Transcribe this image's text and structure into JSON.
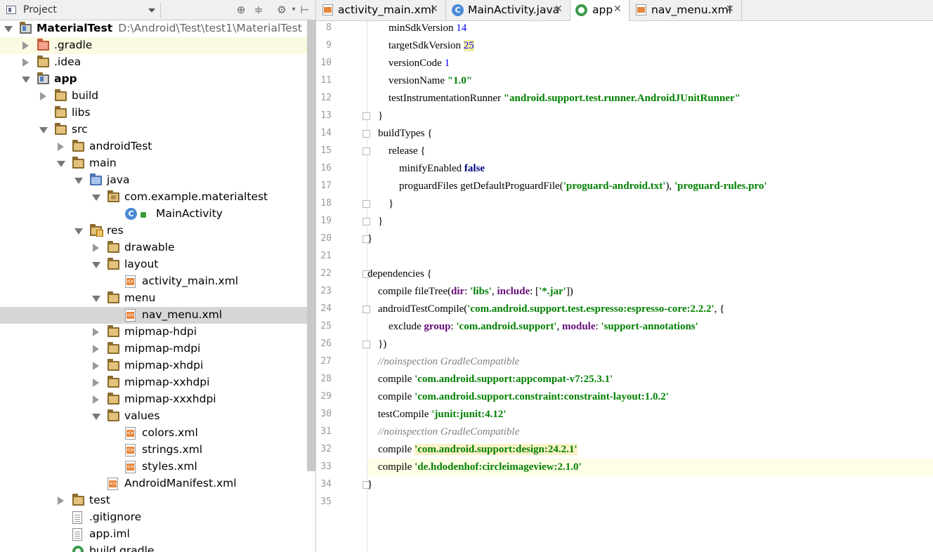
{
  "project_pane": {
    "title": "Project",
    "tree": [
      {
        "label": "MaterialTest",
        "path": "D:\\Android\\Test\\test1\\MaterialTest",
        "depth": 0,
        "arrow": "down",
        "icon": "module-folder",
        "bold": true
      },
      {
        "label": ".gradle",
        "depth": 1,
        "arrow": "right",
        "icon": "folder-red",
        "highlight": "yellow"
      },
      {
        "label": ".idea",
        "depth": 1,
        "arrow": "right",
        "icon": "folder"
      },
      {
        "label": "app",
        "depth": 1,
        "arrow": "down",
        "icon": "module-folder",
        "bold": true
      },
      {
        "label": "build",
        "depth": 2,
        "arrow": "right",
        "icon": "folder"
      },
      {
        "label": "libs",
        "depth": 2,
        "arrow": "none",
        "icon": "folder"
      },
      {
        "label": "src",
        "depth": 2,
        "arrow": "down",
        "icon": "folder"
      },
      {
        "label": "androidTest",
        "depth": 3,
        "arrow": "right",
        "icon": "folder"
      },
      {
        "label": "main",
        "depth": 3,
        "arrow": "down",
        "icon": "folder"
      },
      {
        "label": "java",
        "depth": 4,
        "arrow": "down",
        "icon": "folder-blue"
      },
      {
        "label": "com.example.materialtest",
        "depth": 5,
        "arrow": "down",
        "icon": "package-folder"
      },
      {
        "label": "MainActivity",
        "depth": 6,
        "arrow": "none",
        "icon": "class"
      },
      {
        "label": "res",
        "depth": 4,
        "arrow": "down",
        "icon": "res-folder"
      },
      {
        "label": "drawable",
        "depth": 5,
        "arrow": "right",
        "icon": "folder"
      },
      {
        "label": "layout",
        "depth": 5,
        "arrow": "down",
        "icon": "folder"
      },
      {
        "label": "activity_main.xml",
        "depth": 6,
        "arrow": "none",
        "icon": "xml-file"
      },
      {
        "label": "menu",
        "depth": 5,
        "arrow": "down",
        "icon": "folder"
      },
      {
        "label": "nav_menu.xml",
        "depth": 6,
        "arrow": "none",
        "icon": "xml-file",
        "highlight": "grey"
      },
      {
        "label": "mipmap-hdpi",
        "depth": 5,
        "arrow": "right",
        "icon": "folder"
      },
      {
        "label": "mipmap-mdpi",
        "depth": 5,
        "arrow": "right",
        "icon": "folder"
      },
      {
        "label": "mipmap-xhdpi",
        "depth": 5,
        "arrow": "right",
        "icon": "folder"
      },
      {
        "label": "mipmap-xxhdpi",
        "depth": 5,
        "arrow": "right",
        "icon": "folder"
      },
      {
        "label": "mipmap-xxxhdpi",
        "depth": 5,
        "arrow": "right",
        "icon": "folder"
      },
      {
        "label": "values",
        "depth": 5,
        "arrow": "down",
        "icon": "folder"
      },
      {
        "label": "colors.xml",
        "depth": 6,
        "arrow": "none",
        "icon": "xml-file"
      },
      {
        "label": "strings.xml",
        "depth": 6,
        "arrow": "none",
        "icon": "xml-file"
      },
      {
        "label": "styles.xml",
        "depth": 6,
        "arrow": "none",
        "icon": "xml-file"
      },
      {
        "label": "AndroidManifest.xml",
        "depth": 5,
        "arrow": "none",
        "icon": "manifest-file"
      },
      {
        "label": "test",
        "depth": 3,
        "arrow": "right",
        "icon": "folder"
      },
      {
        "label": ".gitignore",
        "depth": 3,
        "arrow": "none",
        "icon": "text-file"
      },
      {
        "label": "app.iml",
        "depth": 3,
        "arrow": "none",
        "icon": "text-file"
      },
      {
        "label": "build.gradle",
        "depth": 3,
        "arrow": "none",
        "icon": "gradle-file"
      }
    ]
  },
  "tabs": [
    {
      "label": "activity_main.xml",
      "icon": "xml-file-icon",
      "active": false
    },
    {
      "label": "MainActivity.java",
      "icon": "class-icon",
      "active": false
    },
    {
      "label": "app",
      "icon": "gradle-icon",
      "active": true
    },
    {
      "label": "nav_menu.xml",
      "icon": "xml-file-icon",
      "active": false
    }
  ],
  "editor": {
    "current_line": 33,
    "lines": [
      {
        "n": 8,
        "fold": false,
        "tokens": [
          [
            "        minSdkVersion ",
            ""
          ],
          [
            "14",
            "num"
          ]
        ]
      },
      {
        "n": 9,
        "fold": false,
        "tokens": [
          [
            "        targetSdkVersion ",
            ""
          ],
          [
            "25",
            "num-match"
          ]
        ]
      },
      {
        "n": 10,
        "fold": false,
        "tokens": [
          [
            "        versionCode ",
            ""
          ],
          [
            "1",
            "num"
          ]
        ]
      },
      {
        "n": 11,
        "fold": false,
        "tokens": [
          [
            "        versionName ",
            ""
          ],
          [
            "\"1.0\"",
            "str"
          ]
        ]
      },
      {
        "n": 12,
        "fold": false,
        "tokens": [
          [
            "        testInstrumentationRunner ",
            ""
          ],
          [
            "\"android.support.test.runner.AndroidJUnitRunner\"",
            "str"
          ]
        ]
      },
      {
        "n": 13,
        "fold": true,
        "tokens": [
          [
            "    }",
            ""
          ]
        ]
      },
      {
        "n": 14,
        "fold": true,
        "tokens": [
          [
            "    buildTypes {",
            ""
          ]
        ]
      },
      {
        "n": 15,
        "fold": true,
        "tokens": [
          [
            "        release {",
            ""
          ]
        ]
      },
      {
        "n": 16,
        "fold": false,
        "tokens": [
          [
            "            minifyEnabled ",
            ""
          ],
          [
            "false",
            "kw"
          ]
        ]
      },
      {
        "n": 17,
        "fold": false,
        "tokens": [
          [
            "            proguardFiles getDefaultProguardFile(",
            ""
          ],
          [
            "'proguard-android.txt'",
            "str"
          ],
          [
            "), ",
            ""
          ],
          [
            "'proguard-rules.pro'",
            "str"
          ]
        ]
      },
      {
        "n": 18,
        "fold": true,
        "tokens": [
          [
            "        }",
            ""
          ]
        ]
      },
      {
        "n": 19,
        "fold": true,
        "tokens": [
          [
            "    }",
            ""
          ]
        ]
      },
      {
        "n": 20,
        "fold": true,
        "tokens": [
          [
            "}",
            ""
          ]
        ]
      },
      {
        "n": 21,
        "fold": false,
        "tokens": []
      },
      {
        "n": 22,
        "fold": true,
        "tokens": [
          [
            "dependencies {",
            ""
          ]
        ]
      },
      {
        "n": 23,
        "fold": false,
        "tokens": [
          [
            "    compile fileTree(",
            ""
          ],
          [
            "dir",
            "key"
          ],
          [
            ": ",
            ""
          ],
          [
            "'libs'",
            "str"
          ],
          [
            ", ",
            ""
          ],
          [
            "include",
            "key"
          ],
          [
            ": [",
            ""
          ],
          [
            "'*.jar'",
            "str"
          ],
          [
            "])",
            ""
          ]
        ]
      },
      {
        "n": 24,
        "fold": true,
        "tokens": [
          [
            "    androidTestCompile(",
            ""
          ],
          [
            "'com.android.support.test.espresso:espresso-core:2.2.2'",
            "str"
          ],
          [
            ", {",
            ""
          ]
        ]
      },
      {
        "n": 25,
        "fold": false,
        "tokens": [
          [
            "        exclude ",
            ""
          ],
          [
            "group",
            "key"
          ],
          [
            ": ",
            ""
          ],
          [
            "'com.android.support'",
            "str"
          ],
          [
            ", ",
            ""
          ],
          [
            "module",
            "key"
          ],
          [
            ": ",
            ""
          ],
          [
            "'support-annotations'",
            "str"
          ]
        ]
      },
      {
        "n": 26,
        "fold": true,
        "tokens": [
          [
            "    })",
            ""
          ]
        ]
      },
      {
        "n": 27,
        "fold": false,
        "tokens": [
          [
            "    //noinspection GradleCompatible",
            "cmt"
          ]
        ]
      },
      {
        "n": 28,
        "fold": false,
        "tokens": [
          [
            "    compile ",
            ""
          ],
          [
            "'com.android.support:appcompat-v7:25.3.1'",
            "str"
          ]
        ]
      },
      {
        "n": 29,
        "fold": false,
        "tokens": [
          [
            "    compile ",
            ""
          ],
          [
            "'com.android.support.constraint:constraint-layout:1.0.2'",
            "str"
          ]
        ]
      },
      {
        "n": 30,
        "fold": false,
        "tokens": [
          [
            "    testCompile ",
            ""
          ],
          [
            "'junit:junit:4.12'",
            "str"
          ]
        ]
      },
      {
        "n": 31,
        "fold": false,
        "tokens": [
          [
            "    //noinspection GradleCompatible",
            "cmt"
          ]
        ]
      },
      {
        "n": 32,
        "fold": false,
        "tokens": [
          [
            "    compile ",
            ""
          ],
          [
            "'com.android.support:design:24.2.1'",
            "str-target"
          ]
        ]
      },
      {
        "n": 33,
        "fold": false,
        "tokens": [
          [
            "    compile ",
            ""
          ],
          [
            "'de.hdodenhof:circleimageview:2.1.0'",
            "str"
          ]
        ]
      },
      {
        "n": 34,
        "fold": true,
        "tokens": [
          [
            "}",
            ""
          ]
        ]
      },
      {
        "n": 35,
        "fold": false,
        "tokens": []
      }
    ]
  }
}
